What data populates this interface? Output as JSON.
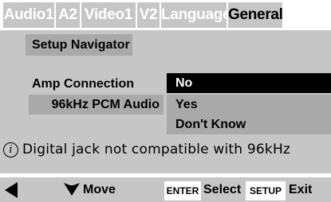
{
  "tabs": [
    {
      "label": "Audio1",
      "active": false
    },
    {
      "label": "A2",
      "active": false
    },
    {
      "label": "Video1",
      "active": false
    },
    {
      "label": "V2",
      "active": false
    },
    {
      "label": "Language",
      "active": false
    },
    {
      "label": "General",
      "active": true
    }
  ],
  "panel": {
    "section_title": "Setup Navigator",
    "question_label": "Amp Connection",
    "sub_label": "96kHz PCM Audio",
    "options": [
      {
        "label": "No",
        "selected": true
      },
      {
        "label": "Yes",
        "selected": false
      },
      {
        "label": "Don't Know",
        "selected": false
      }
    ]
  },
  "info": {
    "icon": "info-circle-icon",
    "icon_glyph": "i",
    "text": "Digital jack not compatible with 96kHz"
  },
  "footer": {
    "move_label": "Move",
    "enter_key": "ENTER",
    "select_label": "Select",
    "setup_key": "SETUP",
    "exit_label": "Exit"
  },
  "colors": {
    "panel_gray": "#c6c6c6",
    "row_gray": "#a9a9a9",
    "selected_bg": "#000000",
    "selected_text": "#ffffff"
  }
}
